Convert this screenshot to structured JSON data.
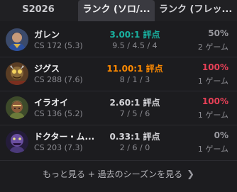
{
  "tabs": [
    {
      "label": "S2026"
    },
    {
      "label": "ランク (ソロ/..."
    },
    {
      "label": "ランク (フレッ..."
    }
  ],
  "colors": {
    "kda_teal": "#19b1a0",
    "kda_orange": "#ff8a00",
    "kda_neutral": "#d6d6da",
    "winrate_red": "#e84057",
    "winrate_gray": "#9a9aa0"
  },
  "champions": [
    {
      "name": "ガレン",
      "cs": "CS 172 (5.3)",
      "kda_ratio": "3.00:1 評点",
      "kda_detail": "9.5 / 4.5 / 4",
      "winrate": "50%",
      "games": "2 ゲーム",
      "kda_color": "#19b1a0",
      "winrate_color": "#9a9aa0",
      "avatar_icon": "garen-portrait-icon"
    },
    {
      "name": "ジグス",
      "cs": "CS 288 (7.6)",
      "kda_ratio": "11.00:1 評点",
      "kda_detail": "8 / 1 / 3",
      "winrate": "100%",
      "games": "1 ゲーム",
      "kda_color": "#ff8a00",
      "winrate_color": "#e84057",
      "avatar_icon": "ziggs-portrait-icon"
    },
    {
      "name": "イラオイ",
      "cs": "CS 136 (5.2)",
      "kda_ratio": "2.60:1 評点",
      "kda_detail": "7 / 5 / 6",
      "winrate": "100%",
      "games": "1 ゲーム",
      "kda_color": "#d6d6da",
      "winrate_color": "#e84057",
      "avatar_icon": "illaoi-portrait-icon"
    },
    {
      "name": "ドクター・ム...",
      "cs": "CS 203 (7.3)",
      "kda_ratio": "0.33:1 評点",
      "kda_detail": "2 / 6 / 0",
      "winrate": "0%",
      "games": "1 ゲーム",
      "kda_color": "#d6d6da",
      "winrate_color": "#9a9aa0",
      "avatar_icon": "dr-mundo-portrait-icon"
    }
  ],
  "more": {
    "label": "もっと見る + 過去のシーズンを見る",
    "icon": "chevron-right-icon"
  }
}
